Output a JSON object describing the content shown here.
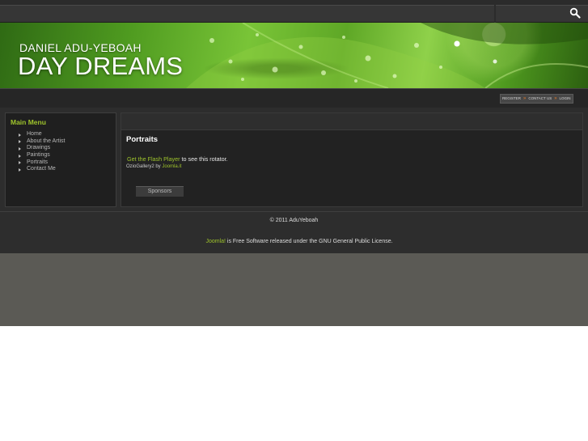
{
  "header": {
    "name": "DANIEL ADU-YEBOAH",
    "title": "DAY DREAMS"
  },
  "top_links": [
    "REGISTER",
    "CONTACT US",
    "LOGIN"
  ],
  "sidebar": {
    "title": "Main Menu",
    "items": [
      "Home",
      "About the Artist",
      "Drawings",
      "Paintings",
      "Portraits",
      "Contact Me"
    ]
  },
  "main": {
    "title": "Portraits",
    "flash_link": "Get the Flash Player",
    "flash_text": " to see this rotator.",
    "credit_prefix": "OzioGallery2 by ",
    "credit_link": "Joomla.it",
    "sponsors_label": "Sponsors"
  },
  "footer": {
    "copyright": "© 2011 AduYeboah",
    "license_link": "Joomla!",
    "license_text": " is Free Software released under the GNU General Public License."
  },
  "colors": {
    "accent": "#9fc42c",
    "background": "#2d2d2d",
    "separator": "#e07a2a"
  }
}
